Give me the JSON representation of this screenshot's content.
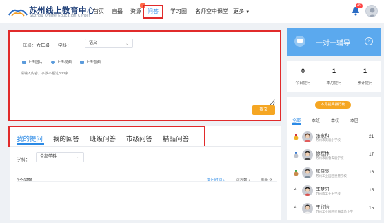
{
  "header": {
    "logo_title": "苏州线上教育中心",
    "logo_subtitle": "Suzhou Online Education Center",
    "nav": [
      "首页",
      "直播",
      "资源",
      "问答",
      "学习圈",
      "名师空中课堂",
      "更多"
    ],
    "active_nav": "问答",
    "notification_count": "49"
  },
  "ask": {
    "grade_label": "年级：",
    "grade_value": "六年级",
    "subject_label": "学科：",
    "subject_value": "语文",
    "upload_image": "上传图片",
    "upload_video": "上传视频",
    "upload_audio": "上传音频",
    "textarea_placeholder": "请输入内容，字数不超过300字",
    "submit_label": "提交"
  },
  "qa": {
    "tabs": [
      "我的提问",
      "我的回答",
      "班级问答",
      "市级问答",
      "精品问答"
    ],
    "active_tab": "我的提问",
    "filter_label": "学科：",
    "filter_value": "全部学科",
    "question_count": "0个问题",
    "sort_time": "提问时间 ↓",
    "sort_answers": "回答数 ↓",
    "refresh": "刷新 ⟳"
  },
  "sidebar": {
    "tutor_label": "一对一辅导",
    "stats": [
      {
        "value": "0",
        "label": "今日提问"
      },
      {
        "value": "1",
        "label": "本月提问"
      },
      {
        "value": "1",
        "label": "累计提问"
      }
    ],
    "rank_title": "本月提问排行榜",
    "rank_tabs": [
      "全部",
      "本班",
      "本校",
      "本区"
    ],
    "rank_active_tab": "全部",
    "rankings": [
      {
        "rank": "1",
        "name": "张家和",
        "school": "苏州市实验小学校",
        "score": "21"
      },
      {
        "rank": "2",
        "name": "徐程林",
        "school": "苏州市新鲁实验学校",
        "score": "17"
      },
      {
        "rank": "3",
        "name": "张晓亮",
        "school": "苏州工业园区星港学校",
        "score": "16"
      },
      {
        "rank": "4",
        "name": "李梦阳",
        "school": "苏州市工业中学校",
        "score": "15"
      },
      {
        "rank": "4",
        "name": "王欣怡",
        "school": "苏州工业园区星海实验小学",
        "score": "15"
      }
    ]
  },
  "colors": {
    "accent": "#2b8ae6",
    "highlight_border": "#e12b2b",
    "submit": "#f5a623",
    "tutor_card": "#5ba9ee"
  }
}
